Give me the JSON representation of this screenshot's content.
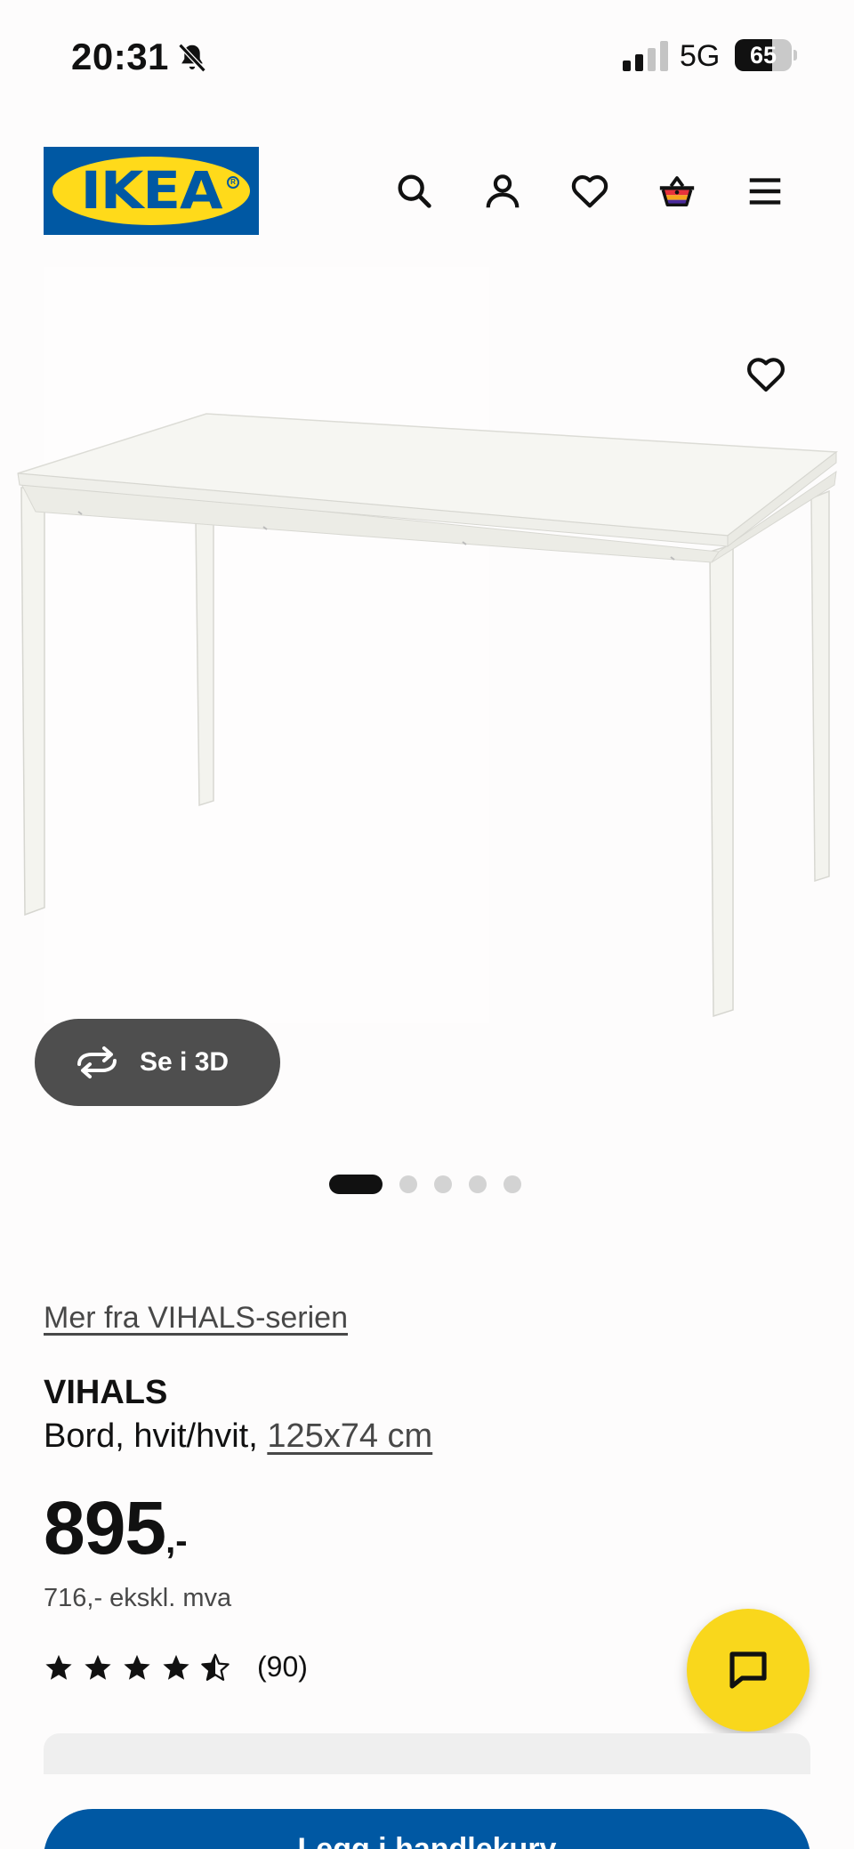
{
  "status_bar": {
    "time": "20:31",
    "network": "5G",
    "battery_level": "65",
    "battery_fraction": 0.65,
    "signal_bars_active": 2,
    "signal_bars_total": 4
  },
  "header": {
    "logo_text": "IKEA",
    "icons": [
      "search-icon",
      "account-icon",
      "wishlist-icon",
      "cart-icon",
      "menu-icon"
    ],
    "brand_blue": "#0058a3",
    "brand_yellow": "#ffda1a"
  },
  "gallery": {
    "view_3d_label": "Se i 3D",
    "image_count": 5,
    "active_index": 0
  },
  "product": {
    "series_link": "Mer fra VIHALS-serien",
    "name": "VIHALS",
    "description_prefix": "Bord, hvit/hvit, ",
    "size_link": "125x74 cm",
    "price_main": "895",
    "price_suffix": ",-",
    "price_excl_vat": "716,- ekskl. mva",
    "rating_stars": 4.5,
    "rating_count": "(90)"
  },
  "actions": {
    "add_to_cart_label": "Legg i handlekurv",
    "chat_color": "#f9d71c"
  }
}
